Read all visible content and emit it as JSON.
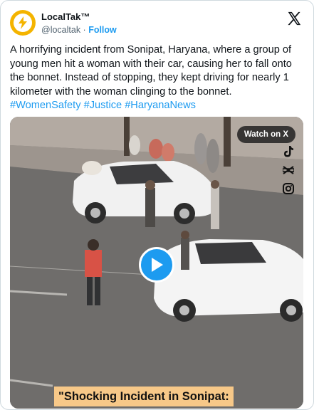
{
  "account": {
    "name": "LocalTak™",
    "handle": "@localtak",
    "separator": " · ",
    "follow_label": "Follow"
  },
  "tweet": {
    "text": "A horrifying incident from Sonipat, Haryana, where a group of young men hit a woman with their car, causing her to fall onto the bonnet. Instead of stopping, they kept driving for nearly 1 kilometer with the woman clinging to the bonnet.",
    "hashtags": [
      "#WomenSafety",
      "#Justice",
      "#HaryanaNews"
    ]
  },
  "media": {
    "watch_label": "Watch on X",
    "caption": "\"Shocking Incident in Sonipat:",
    "icons": [
      "tiktok-icon",
      "capcut-icon",
      "instagram-icon"
    ]
  },
  "colors": {
    "accent": "#1d9bf0",
    "avatar": "#f4b400",
    "caption_bg": "#f7c888"
  }
}
